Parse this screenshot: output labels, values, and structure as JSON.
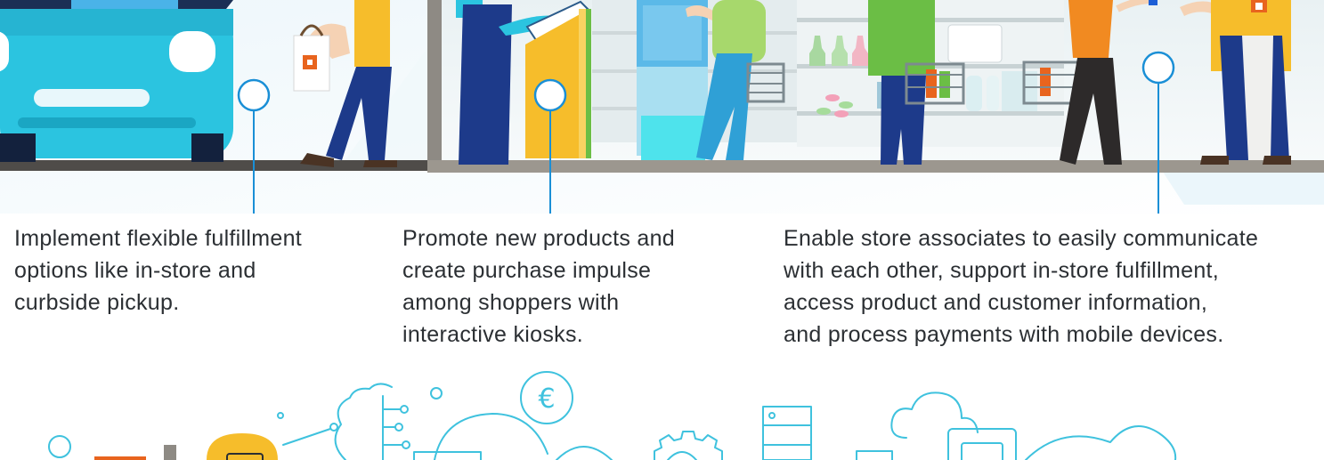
{
  "captions": [
    {
      "lines": [
        "Implement flexible fulfillment",
        "options like in-store and",
        "curbside pickup."
      ]
    },
    {
      "lines": [
        "Promote new products and",
        "create purchase impulse",
        "among shoppers with",
        "interactive kiosks."
      ]
    },
    {
      "lines": [
        "Enable store associates to easily communicate",
        "with each other, support in-store fulfillment,",
        "access product and customer information,",
        "and process payments with mobile devices."
      ]
    }
  ],
  "icons": {
    "currency_symbol": "€"
  },
  "colors": {
    "text": "#2b2f33",
    "callout_line": "#1a8fd6",
    "car_body": "#2bc4e0",
    "kiosk_yellow": "#f6bd2b",
    "shirt_green": "#6bbe45",
    "shirt_orange": "#f18a21",
    "pants_navy": "#1d3a8a",
    "floor_gray": "#8a8680",
    "icon_line": "#3fc2de",
    "brand_orange": "#e8641e"
  }
}
